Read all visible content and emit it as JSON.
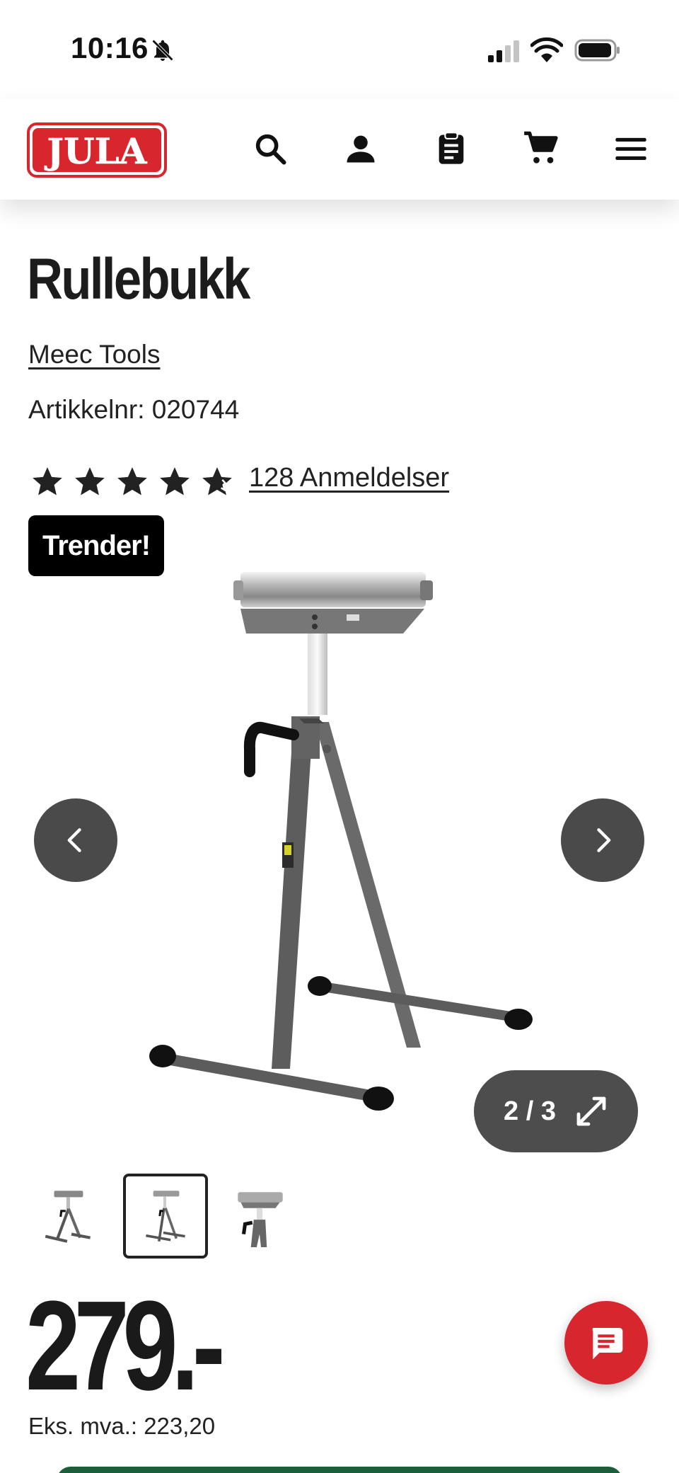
{
  "status_bar": {
    "time": "10:16",
    "icons": [
      "bell-muted-icon",
      "cellular-signal-icon",
      "wifi-icon",
      "battery-icon"
    ]
  },
  "header": {
    "logo_text": "JULA",
    "icons": [
      "search-icon",
      "account-icon",
      "shopping-list-icon",
      "cart-icon",
      "menu-icon"
    ]
  },
  "product": {
    "title": "Rullebukk",
    "brand": "Meec Tools",
    "article_label": "Artikkelnr:",
    "article_number": "020744",
    "rating": 4.5,
    "reviews_label": "128 Anmeldelser",
    "badge": "Trender!"
  },
  "gallery": {
    "counter": "2 / 3",
    "current_index": 2,
    "total": 3,
    "thumbnails": [
      "product-thumbnail-1",
      "product-thumbnail-2",
      "product-thumbnail-3"
    ]
  },
  "price": {
    "amount": "279.-",
    "ex_vat": "Eks. mva.: 223,20"
  },
  "colors": {
    "brand_red": "#d7262e",
    "dark_button": "#4a4a4a",
    "badge_black": "#000000"
  }
}
